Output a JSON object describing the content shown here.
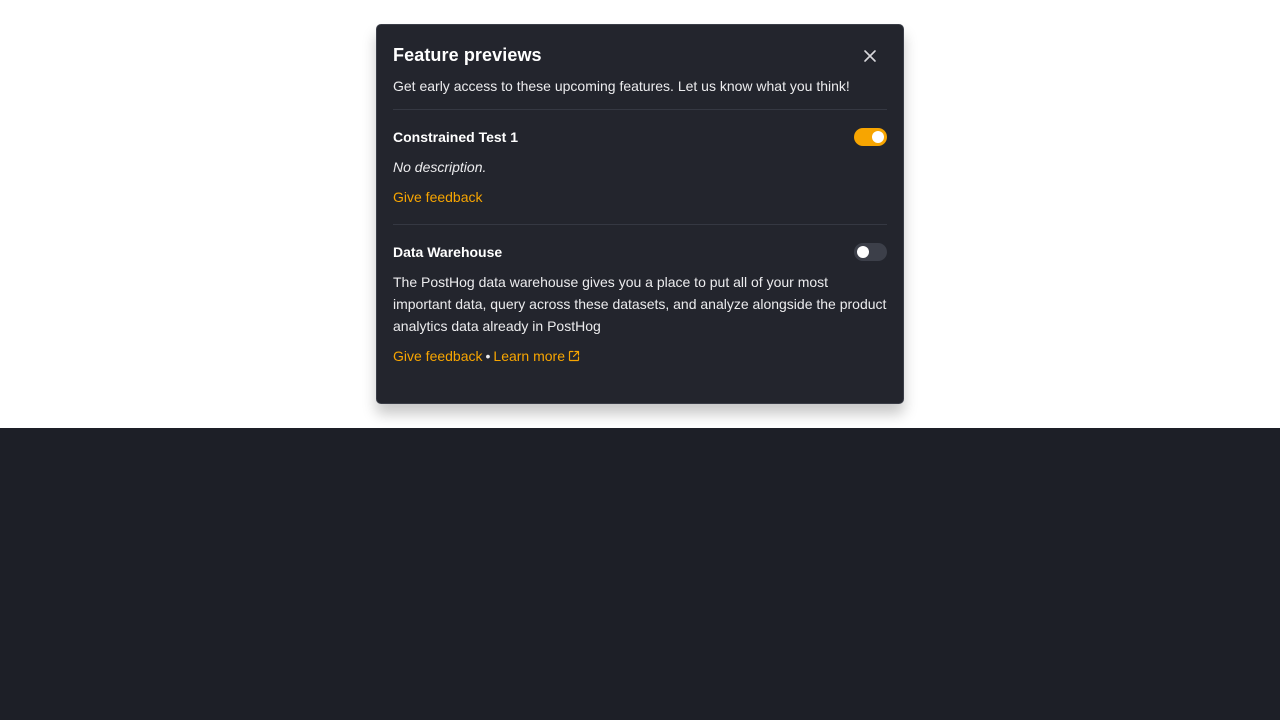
{
  "modal": {
    "title": "Feature previews",
    "intro": "Get early access to these upcoming features. Let us know what you think!",
    "close_icon": "close-icon"
  },
  "features": [
    {
      "name": "Constrained Test 1",
      "enabled": true,
      "description": "No description.",
      "feedback_label": "Give feedback"
    },
    {
      "name": "Data Warehouse",
      "enabled": false,
      "description": "The PostHog data warehouse gives you a place to put all of your most important data, query across these datasets, and analyze alongside the product analytics data already in PostHog",
      "feedback_label": "Give feedback",
      "separator": "•",
      "learn_more_label": "Learn more",
      "learn_more_icon": "external-link-icon"
    }
  ],
  "colors": {
    "accent": "#f7a501",
    "panel_bg": "#23252d",
    "page_bg": "#1d1f27",
    "toggle_off": "#3c3f49"
  }
}
